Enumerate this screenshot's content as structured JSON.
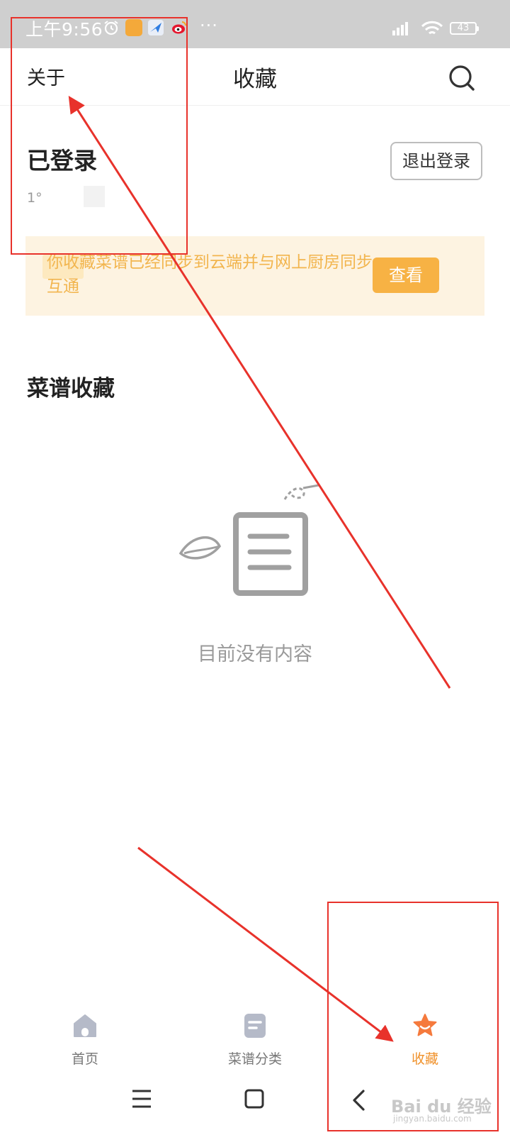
{
  "status_bar": {
    "time": "上午9:56",
    "more": "···",
    "battery": "43"
  },
  "header": {
    "about_label": "关于",
    "title": "收藏",
    "search_icon": "search-icon"
  },
  "account": {
    "status": "已登录",
    "id_partial": "1°",
    "logout_label": "退出登录"
  },
  "sync_banner": {
    "text": "你收藏菜谱已经同步到云端并与网上厨房同步互通",
    "button_label": "查看"
  },
  "favorites": {
    "section_title": "菜谱收藏",
    "empty_text": "目前没有内容"
  },
  "tabbar": {
    "items": [
      {
        "label": "首页",
        "icon": "home-icon"
      },
      {
        "label": "菜谱分类",
        "icon": "recipe-category-icon"
      },
      {
        "label": "收藏",
        "icon": "favorite-star-icon"
      }
    ],
    "active_color": "#f0922c",
    "inactive_color": "#b5bac8"
  },
  "system_nav": [
    "menu-icon",
    "home-square-icon",
    "back-chevron-icon"
  ],
  "watermark": {
    "brand": "Bai du 经验",
    "url": "jingyan.baidu.com"
  },
  "colors": {
    "accent": "#f7b244",
    "banner_bg": "#fdf3e1",
    "annotation_red": "#e8322b"
  }
}
